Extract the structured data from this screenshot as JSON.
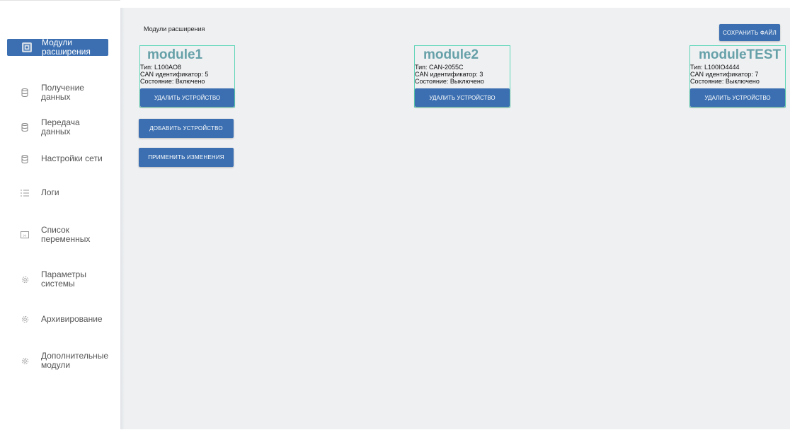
{
  "page": {
    "title": "Модули расширения",
    "save_file_label": "СОХРАНИТЬ ФАЙЛ",
    "add_device_label": "ДОБАВИТЬ УСТРОЙСТВО",
    "apply_changes_label": "ПРИМЕНИТЬ ИЗМЕНЕНИЯ"
  },
  "sidebar": {
    "items": [
      {
        "label": "Модули расширения",
        "icon": "module-icon",
        "active": true
      },
      {
        "label": "Получение данных",
        "icon": "database-icon"
      },
      {
        "label": "Передача данных",
        "icon": "database-icon"
      },
      {
        "label": "Настройки сети",
        "icon": "database-icon"
      },
      {
        "label": "Логи",
        "icon": "list-icon"
      },
      {
        "label": "Список переменных",
        "icon": "variables-icon"
      },
      {
        "label": "Параметры системы",
        "icon": "gear-icon"
      },
      {
        "label": "Архивирование",
        "icon": "gear-icon"
      },
      {
        "label": "Дополнительные модули",
        "icon": "gear-icon"
      }
    ]
  },
  "modules": [
    {
      "name": "module1",
      "type": "Тип: L100AO8",
      "can_id": "CAN идентификатор: 5",
      "state": "Состояние: Включено",
      "delete_label": "УДАЛИТЬ УСТРОЙСТВО"
    },
    {
      "name": "module2",
      "type": "Тип: CAN-2055C",
      "can_id": "CAN идентификатор: 3",
      "state": "Состояние: Выключено",
      "delete_label": "УДАЛИТЬ УСТРОЙСТВО"
    },
    {
      "name": "moduleTEST",
      "type": "Тип: L100IO4444",
      "can_id": "CAN идентификатор: 7",
      "state": "Состояние: Выключено",
      "delete_label": "УДАЛИТЬ УСТРОЙСТВО"
    }
  ],
  "colors": {
    "accent": "#3b6fb1",
    "card_border": "#5fd6b8",
    "module_name": "#66a0a8",
    "background": "#eef0f2"
  }
}
